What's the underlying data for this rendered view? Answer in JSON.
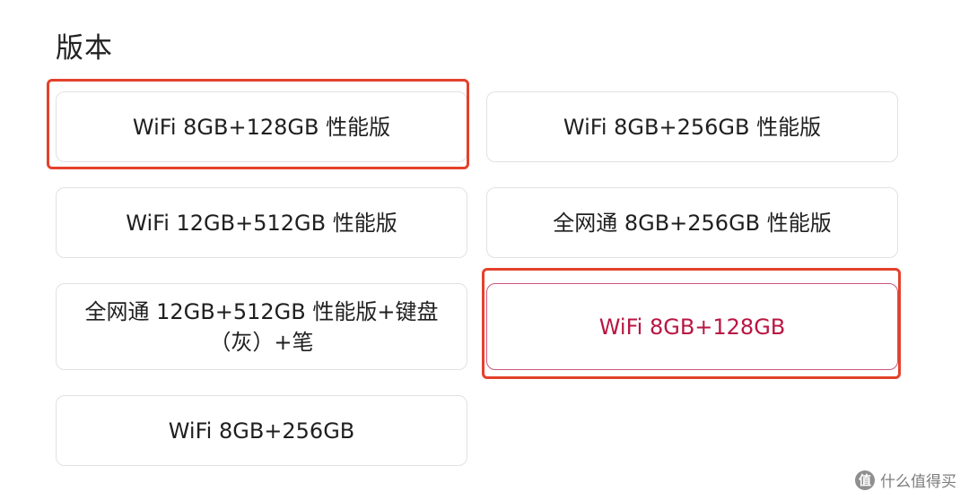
{
  "section": {
    "title": "版本"
  },
  "options": [
    {
      "label": "WiFi 8GB+128GB 性能版",
      "selected": false
    },
    {
      "label": "WiFi 8GB+256GB 性能版",
      "selected": false
    },
    {
      "label": "WiFi 12GB+512GB 性能版",
      "selected": false
    },
    {
      "label": "全网通 8GB+256GB 性能版",
      "selected": false
    },
    {
      "label": "全网通 12GB+512GB 性能版+键盘（灰）+笔",
      "selected": false
    },
    {
      "label": "WiFi 8GB+128GB",
      "selected": true
    },
    {
      "label": "WiFi 8GB+256GB",
      "selected": false
    }
  ],
  "watermark": {
    "logo": "值",
    "text": "什么值得买"
  },
  "colors": {
    "selected_text": "#b91642",
    "highlight_border": "#e4412c",
    "option_border": "#e1e1e1"
  }
}
